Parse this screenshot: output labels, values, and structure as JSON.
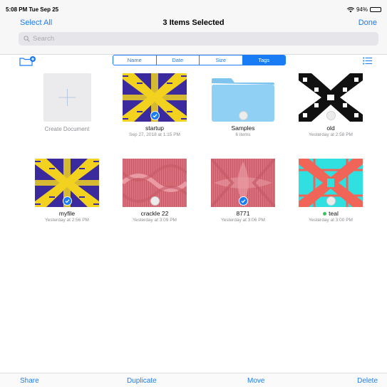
{
  "status_bar": {
    "time": "5:08 PM  Tue Sep 25",
    "battery": "94%",
    "battery_level": 0.94
  },
  "nav": {
    "select_all": "Select All",
    "title": "3 Items Selected",
    "done": "Done"
  },
  "search": {
    "placeholder": "Search"
  },
  "sort_tabs": [
    {
      "label": "Name",
      "active": false
    },
    {
      "label": "Date",
      "active": false
    },
    {
      "label": "Size",
      "active": false
    },
    {
      "label": "Tags",
      "active": true
    }
  ],
  "create_document": {
    "label": "Create Document"
  },
  "items": [
    {
      "name": "startup",
      "subtitle": "Sep 27, 2018 at 1:15 PM",
      "selected": true,
      "kind": "document"
    },
    {
      "name": "Samples",
      "subtitle": "6 items",
      "selected": false,
      "kind": "folder"
    },
    {
      "name": "old",
      "subtitle": "Yesterday at 2:58 PM",
      "selected": false,
      "kind": "document"
    },
    {
      "name": "myfile",
      "subtitle": "Yesterday at 2:56 PM",
      "selected": true,
      "kind": "document"
    },
    {
      "name": "crackle 22",
      "subtitle": "Yesterday at 3:09 PM",
      "selected": false,
      "kind": "document"
    },
    {
      "name": "8771",
      "subtitle": "Yesterday at 3:06 PM",
      "selected": true,
      "kind": "document"
    },
    {
      "name": "teal",
      "subtitle": "Yesterday at 3:00 PM",
      "selected": false,
      "kind": "document",
      "tag_color": "#34c759"
    }
  ],
  "bottom_bar": {
    "share": "Share",
    "duplicate": "Duplicate",
    "move": "Move",
    "delete": "Delete"
  },
  "colors": {
    "accent": "#1a7cf5",
    "weave_purple": "#3a2a9e",
    "weave_yellow": "#f2d21f",
    "weave_black": "#111111",
    "weave_pink": "#d9707c",
    "weave_cyan": "#30dfe0",
    "weave_coral": "#f06557",
    "folder_blue": "#7ec4ee"
  },
  "icons": {
    "wifi": "wifi-icon",
    "battery": "battery-icon",
    "search": "search-icon",
    "new_folder": "new-folder-icon",
    "list_view": "list-view-icon",
    "checkmark": "checkmark-icon"
  }
}
